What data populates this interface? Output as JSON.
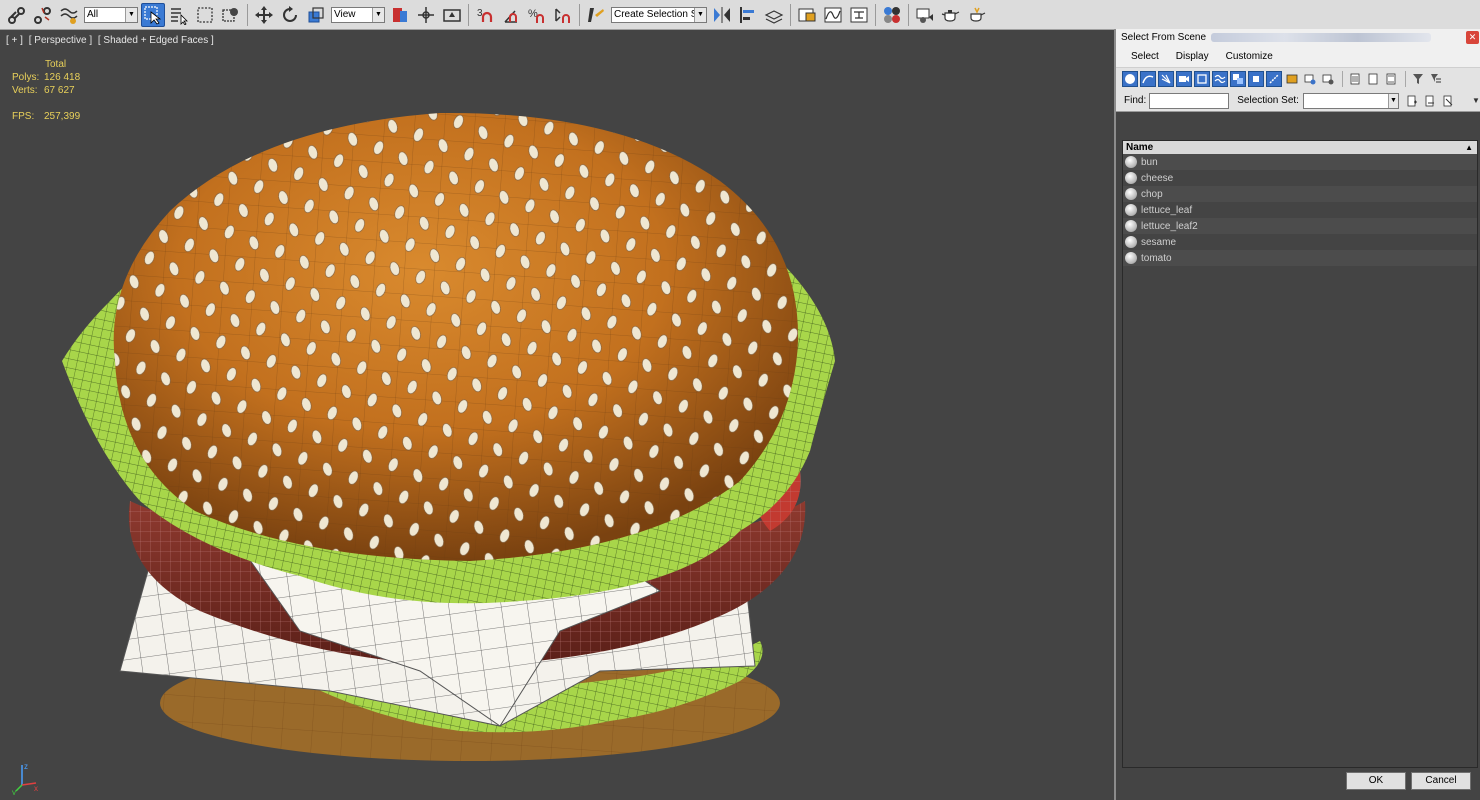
{
  "toolbar": {
    "selection_filter": "All",
    "reference_coord": "View",
    "named_selection": "Create Selection Se",
    "snaps": [
      "3",
      "%"
    ]
  },
  "viewport": {
    "labels": [
      "[ + ]",
      "[ Perspective ]",
      "[ Shaded + Edged Faces ]"
    ],
    "stats": {
      "total_label": "Total",
      "polys_label": "Polys:",
      "polys_value": "126 418",
      "verts_label": "Verts:",
      "verts_value": "67 627",
      "fps_label": "FPS:",
      "fps_value": "257,399"
    },
    "axis": {
      "x": "x",
      "y": "y",
      "z": "z"
    }
  },
  "dialog": {
    "title": "Select From Scene",
    "menu": [
      "Select",
      "Display",
      "Customize"
    ],
    "find_label": "Find:",
    "selection_set_label": "Selection Set:",
    "column_header": "Name",
    "items": [
      "bun",
      "cheese",
      "chop",
      "lettuce_leaf",
      "lettuce_leaf2",
      "sesame",
      "tomato"
    ],
    "ok_label": "OK",
    "cancel_label": "Cancel"
  },
  "colors": {
    "accent": "#3a7ad4",
    "stats": "#e8d05a",
    "viewport_bg": "#444444",
    "bun": "#c8731e",
    "lettuce": "#a8d64a",
    "patty": "#7a2a22",
    "cheese": "#f4f2ec"
  }
}
